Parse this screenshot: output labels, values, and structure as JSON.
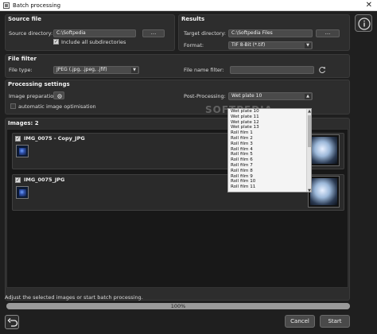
{
  "window": {
    "title": "Batch processing",
    "close_glyph": "✕"
  },
  "source_file": {
    "title": "Source file",
    "source_directory_label": "Source directory:",
    "source_directory_value": "C:\\Softpedia",
    "browse_label": "...",
    "include_subdirs_label": "Include all subdirectories",
    "include_subdirs_checked": true
  },
  "results": {
    "title": "Results",
    "target_directory_label": "Target directory:",
    "target_directory_value": "C:\\Softpedia Files",
    "browse_label": "...",
    "format_label": "Format:",
    "format_value": "TIF 8-Bit (*.tif)"
  },
  "file_filter": {
    "title": "File filter",
    "file_type_label": "File type:",
    "file_type_value": "JPEG (.jpg, .jpeg, .jfif)",
    "file_name_filter_label": "File name filter:",
    "file_name_filter_value": ""
  },
  "processing_settings": {
    "title": "Processing settings",
    "image_preparation_label": "Image preparation:",
    "automatic_optimisation_label": "automatic image optimisation",
    "automatic_optimisation_checked": false,
    "post_processing_label": "Post-Processing:",
    "post_processing_value": "Wet plate 10",
    "options": [
      "Wet plate 10",
      "Wet plate 11",
      "Wet plate 12",
      "Wet plate 13",
      "Roll film 1",
      "Roll film 2",
      "Roll film 3",
      "Roll film 4",
      "Roll film 5",
      "Roll film 6",
      "Roll film 7",
      "Roll film 8",
      "Roll film 9",
      "Roll film 10",
      "Roll film 11"
    ],
    "watermark_text": "SOFTPEDIA"
  },
  "images": {
    "title": "Images: 2",
    "items": [
      {
        "name": "IMG_0075 - Copy_JPG",
        "checked": true
      },
      {
        "name": "IMG_0075_JPG",
        "checked": true
      }
    ]
  },
  "status": {
    "message": "Adjust the selected images or start batch processing.",
    "progress_percent": 100,
    "progress_label": "100%"
  },
  "buttons": {
    "cancel_label": "Cancel",
    "start_label": "Start"
  },
  "icons": {
    "info": "info-icon",
    "undo": "undo-icon",
    "refresh": "refresh-icon",
    "gear": "gear-icon"
  }
}
